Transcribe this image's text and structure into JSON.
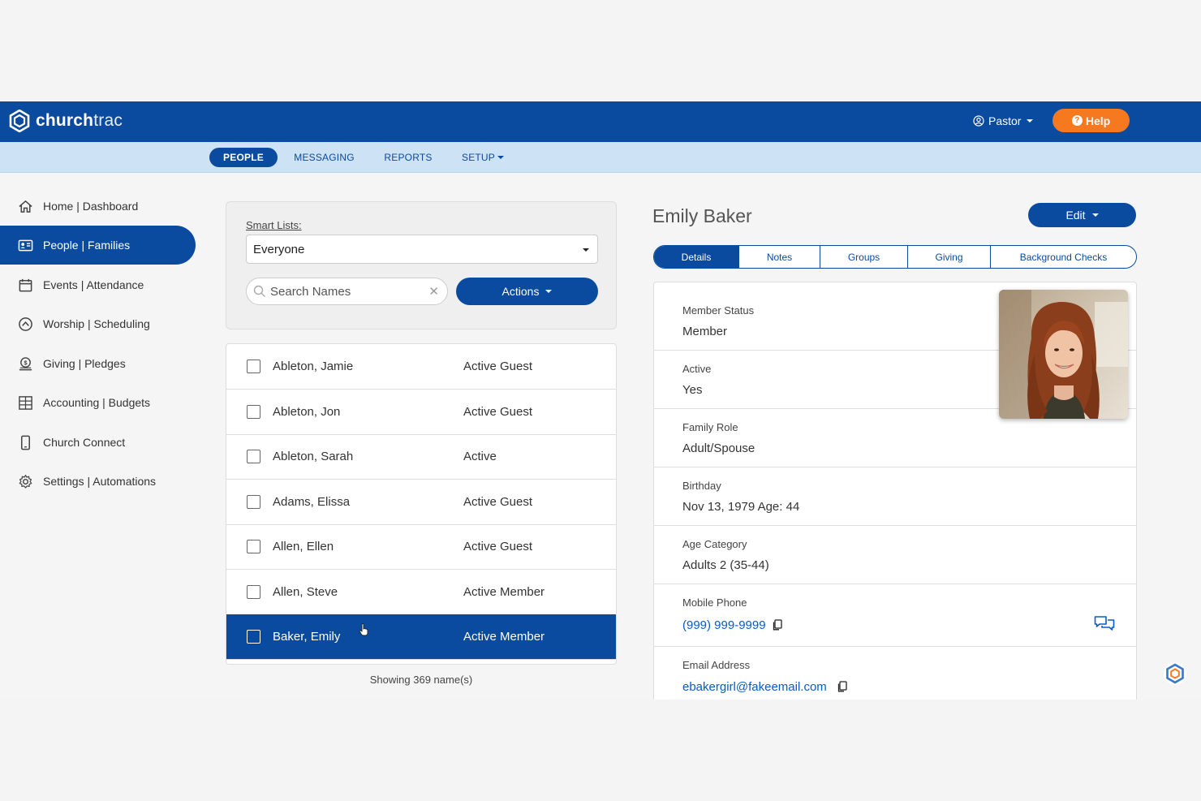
{
  "brand": {
    "name_bold": "church",
    "name_light": "trac"
  },
  "header": {
    "user_label": "Pastor",
    "help_label": "Help"
  },
  "subnav": {
    "items": [
      {
        "label": "PEOPLE"
      },
      {
        "label": "MESSAGING"
      },
      {
        "label": "REPORTS"
      },
      {
        "label": "SETUP"
      }
    ]
  },
  "sidebar": {
    "items": [
      {
        "label": "Home | Dashboard",
        "icon": "home-icon"
      },
      {
        "label": "People | Families",
        "icon": "id-card-icon"
      },
      {
        "label": "Events | Attendance",
        "icon": "calendar-icon"
      },
      {
        "label": "Worship | Scheduling",
        "icon": "worship-icon"
      },
      {
        "label": "Giving | Pledges",
        "icon": "giving-icon"
      },
      {
        "label": "Accounting | Budgets",
        "icon": "grid-icon"
      },
      {
        "label": "Church Connect",
        "icon": "phone-icon"
      },
      {
        "label": "Settings | Automations",
        "icon": "gear-icon"
      }
    ]
  },
  "filters": {
    "smart_lists_label": "Smart Lists:",
    "smart_list_value": "Everyone",
    "search_placeholder": "Search Names",
    "actions_label": "Actions"
  },
  "people": [
    {
      "name": "Ableton, Jamie",
      "status": "Active Guest"
    },
    {
      "name": "Ableton, Jon",
      "status": "Active Guest"
    },
    {
      "name": "Ableton, Sarah",
      "status": "Active"
    },
    {
      "name": "Adams, Elissa",
      "status": "Active Guest"
    },
    {
      "name": "Allen, Ellen",
      "status": "Active Guest"
    },
    {
      "name": "Allen, Steve",
      "status": "Active Member"
    },
    {
      "name": "Baker, Emily",
      "status": "Active Member"
    }
  ],
  "showing_text": "Showing 369 name(s)",
  "detail": {
    "name": "Emily Baker",
    "edit_label": "Edit",
    "tabs": [
      {
        "label": "Details"
      },
      {
        "label": "Notes"
      },
      {
        "label": "Groups"
      },
      {
        "label": "Giving"
      },
      {
        "label": "Background Checks"
      }
    ],
    "fields": [
      {
        "label": "Member Status",
        "value": "Member"
      },
      {
        "label": "Active",
        "value": "Yes"
      },
      {
        "label": "Family Role",
        "value": "Adult/Spouse"
      },
      {
        "label": "Birthday",
        "value": "Nov 13, 1979 Age: 44"
      },
      {
        "label": "Age Category",
        "value": "Adults 2 (35-44)"
      },
      {
        "label": "Mobile Phone",
        "value": "(999) 999-9999"
      },
      {
        "label": "Email Address",
        "value": "ebakergirl@fakeemail.com"
      }
    ]
  },
  "colors": {
    "primary": "#0a4a9f",
    "accent": "#f6781f",
    "subnav": "#cde3f5"
  }
}
